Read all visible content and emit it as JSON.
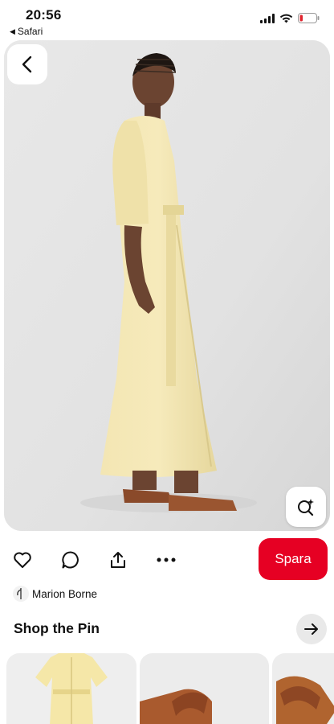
{
  "status_bar": {
    "time": "20:56",
    "back_app_label": "Safari",
    "icons": [
      "cellular-signal-icon",
      "wifi-icon",
      "battery-low-icon"
    ]
  },
  "pin": {
    "image_icons": [
      "chevron-left-icon",
      "visual-search-icon"
    ]
  },
  "actions": {
    "icons": [
      "heart-icon",
      "comment-icon",
      "share-icon",
      "more-icon"
    ],
    "save_label": "Spara",
    "save_color": "#e60023"
  },
  "creator": {
    "name": "Marion Borne"
  },
  "shop": {
    "title": "Shop the Pin",
    "arrow_icon": "arrow-right-icon",
    "products": [
      "dress-thumbnail",
      "sandal-thumbnail",
      "sandal-thumbnail"
    ]
  }
}
